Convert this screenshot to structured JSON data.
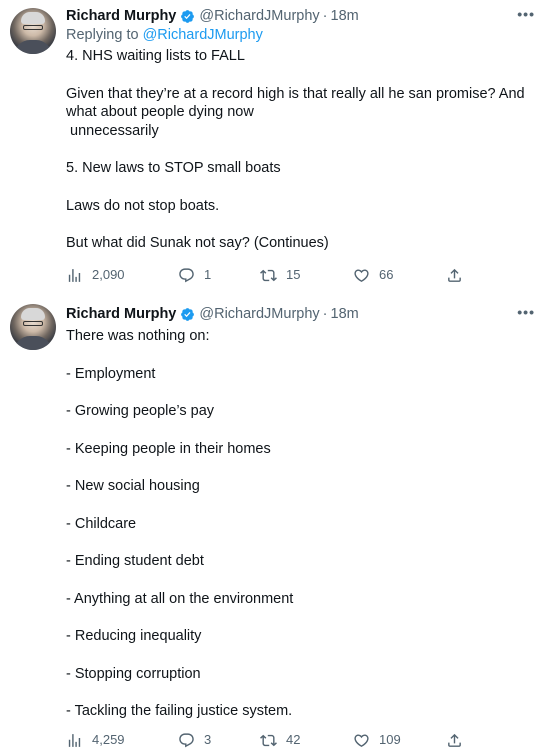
{
  "tweets": [
    {
      "author": {
        "display_name": "Richard Murphy",
        "handle": "@RichardJMurphy",
        "verified": true,
        "time": "18m"
      },
      "replying_to": {
        "prefix": "Replying to",
        "handle": "@RichardJMurphy"
      },
      "paragraphs": [
        "4. NHS waiting lists to FALL",
        "Given that they’re at a record high is that really all he san promise? And what about people dying now\n unnecessarily",
        "5. New laws to STOP small boats",
        "Laws do not stop boats.",
        "But what did Sunak not say? (Continues)"
      ],
      "stats": {
        "views": "2,090",
        "replies": "1",
        "retweets": "15",
        "likes": "66"
      }
    },
    {
      "author": {
        "display_name": "Richard Murphy",
        "handle": "@RichardJMurphy",
        "verified": true,
        "time": "18m"
      },
      "paragraphs": [
        "There was nothing on:",
        "- Employment",
        "- Growing people’s pay",
        "- Keeping people in their homes",
        "- New social housing",
        "- Childcare",
        "- Ending student debt",
        "- Anything at all on the environment",
        "- Reducing inequality",
        "- Stopping corruption",
        "- Tackling the failing justice system."
      ],
      "stats": {
        "views": "4,259",
        "replies": "3",
        "retweets": "42",
        "likes": "109"
      }
    }
  ],
  "ui": {
    "separator_dot": "·",
    "more_glyph": "•••"
  },
  "colors": {
    "text_primary": "#0f1419",
    "text_secondary": "#536471",
    "accent": "#1d9bf0"
  },
  "icons": [
    "views-icon",
    "reply-icon",
    "retweet-icon",
    "like-icon",
    "share-icon",
    "verified-badge-icon",
    "more-options-icon"
  ]
}
